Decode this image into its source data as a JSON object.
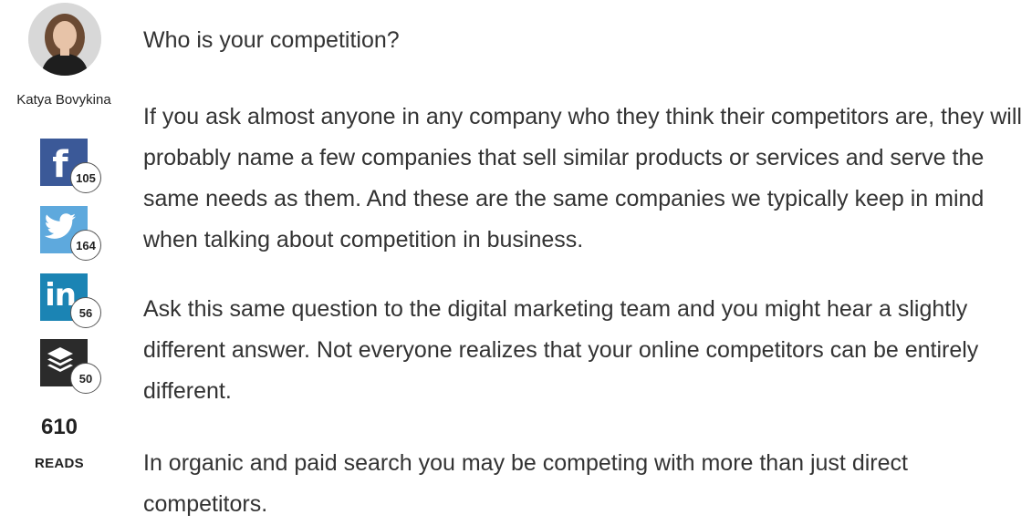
{
  "author": {
    "name": "Katya Bovykina"
  },
  "shares": [
    {
      "network": "facebook",
      "icon": "facebook-icon",
      "count": "105",
      "color": "#3b5998"
    },
    {
      "network": "twitter",
      "icon": "twitter-icon",
      "count": "164",
      "color": "#5ea9dd"
    },
    {
      "network": "linkedin",
      "icon": "linkedin-icon",
      "count": "56",
      "color": "#1b84b4"
    },
    {
      "network": "buffer",
      "icon": "buffer-icon",
      "count": "50",
      "color": "#2b2b2b"
    }
  ],
  "reads": {
    "count": "610",
    "label": "READS"
  },
  "article": {
    "heading": "Who is your competition?",
    "paragraphs": [
      "If you ask almost anyone in any company who they think their competitors are, they will probably name a few companies that sell similar products or services and serve the same needs as them. And these are the same companies we typically keep in mind when talking about competition in business.",
      "Ask this same question to the digital marketing team and you might hear a slightly different answer. Not everyone realizes that your online competitors can be entirely different.",
      "In organic and paid search you may be competing with more than just direct competitors."
    ]
  }
}
